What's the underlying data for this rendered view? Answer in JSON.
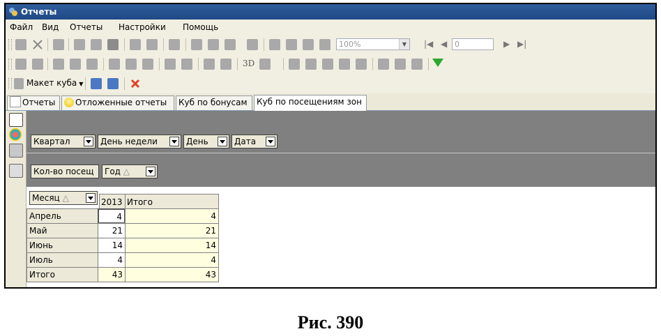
{
  "window": {
    "title": "Отчеты"
  },
  "menu": [
    "Файл",
    "Вид",
    "Отчеты",
    "Настройки",
    "Помощь"
  ],
  "toolbar1": {
    "zoom": "100%",
    "page": "0",
    "first_icon": "first-page-icon",
    "prev_icon": "prev-page-icon",
    "next_icon": "next-page-icon",
    "last_icon": "last-page-icon"
  },
  "toolbar2": {
    "threed_label": "3D"
  },
  "toolbar3": {
    "maket_label": "Макет куба"
  },
  "tabs": [
    {
      "label": "Отчеты",
      "active": false
    },
    {
      "label": "Отложенные отчеты",
      "active": false
    },
    {
      "label": "Куб по бонусам",
      "active": false
    },
    {
      "label": "Куб по посещениям зон",
      "active": true
    }
  ],
  "pivot": {
    "filter_fields": [
      "Квартал",
      "День недели",
      "День",
      "Дата"
    ],
    "data_field": "Кол-во посещ",
    "column_field": "Год",
    "row_field": "Месяц",
    "sort_glyph": "△",
    "column_headers": [
      "2013",
      "Итого"
    ],
    "rows": [
      {
        "label": "Апрель",
        "c2013": "4",
        "total": "4"
      },
      {
        "label": "Май",
        "c2013": "21",
        "total": "21"
      },
      {
        "label": "Июнь",
        "c2013": "14",
        "total": "14"
      },
      {
        "label": "Июль",
        "c2013": "4",
        "total": "4"
      },
      {
        "label": "Итого",
        "c2013": "43",
        "total": "43"
      }
    ]
  },
  "colors": {
    "title_bar": "#1e4a87",
    "pivot_gray": "#808080",
    "total_fill": "#ffffe0",
    "filter_green": "#2ea82e"
  },
  "caption": "Рис. 390"
}
